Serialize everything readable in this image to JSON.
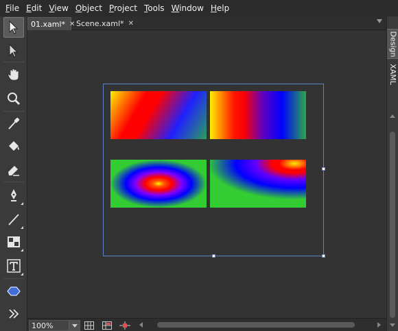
{
  "menu": {
    "items": [
      "File",
      "Edit",
      "View",
      "Object",
      "Project",
      "Tools",
      "Window",
      "Help"
    ]
  },
  "tabs": [
    {
      "label": "01.xaml*",
      "close": "✕"
    },
    {
      "label": "Scene.xaml*",
      "close": "✕"
    }
  ],
  "right_panel": {
    "design_label": "Design",
    "xaml_label": "XAML"
  },
  "status": {
    "zoom": "100%"
  },
  "tools": [
    "selection-tool",
    "direct-selection-tool",
    "pan-tool",
    "zoom-tool",
    "eyedropper-tool",
    "paint-bucket-tool",
    "brush-transform-tool",
    "pen-tool",
    "line-tool",
    "layout-panel-tool",
    "text-tool",
    "shape-tool",
    "asset-library-tool"
  ],
  "colors": {
    "background": "#333333",
    "selection_border": "#5c86c9",
    "gradient_red": "#ff0000",
    "gradient_blue": "#0000ff",
    "gradient_yellow": "#ffee00",
    "gradient_green": "#33cc33"
  }
}
